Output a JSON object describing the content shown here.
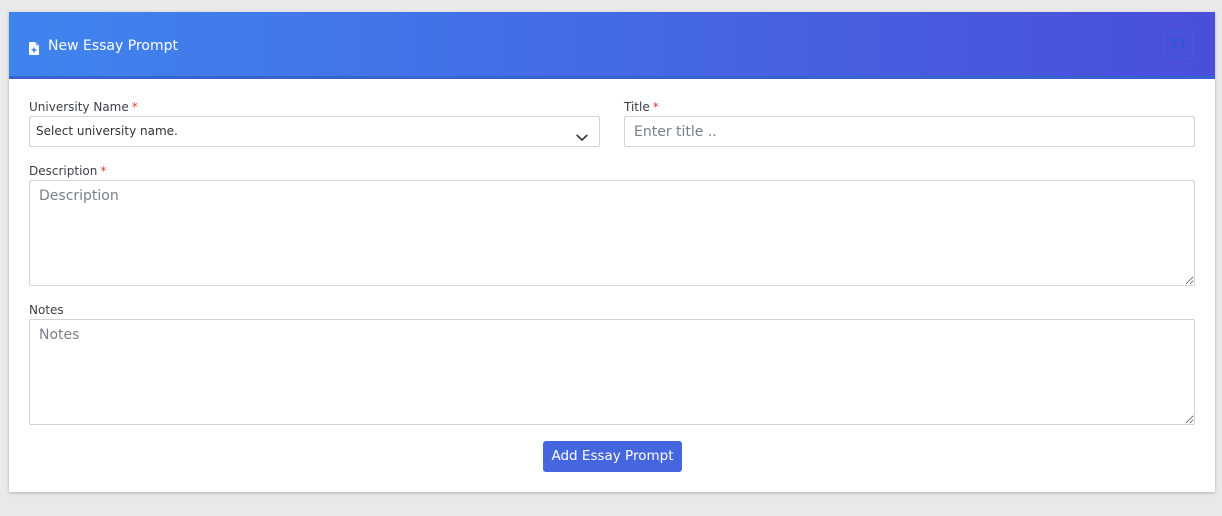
{
  "header": {
    "title": "New Essay Prompt",
    "title_icon": "file-add-icon",
    "reset_icon": "undo-icon"
  },
  "form": {
    "university": {
      "label": "University Name",
      "required_mark": "*",
      "selected_value": "Select university name."
    },
    "title": {
      "label": "Title",
      "required_mark": "*",
      "placeholder": "Enter title .."
    },
    "description": {
      "label": "Description",
      "required_mark": "*",
      "placeholder": "Description"
    },
    "notes": {
      "label": "Notes",
      "placeholder": "Notes"
    },
    "submit_label": "Add Essay Prompt"
  },
  "colors": {
    "header_gradient_start": "#3f85ee",
    "header_gradient_end": "#4a4edb",
    "primary_button": "#4666df",
    "required_mark": "#e23b3b"
  }
}
